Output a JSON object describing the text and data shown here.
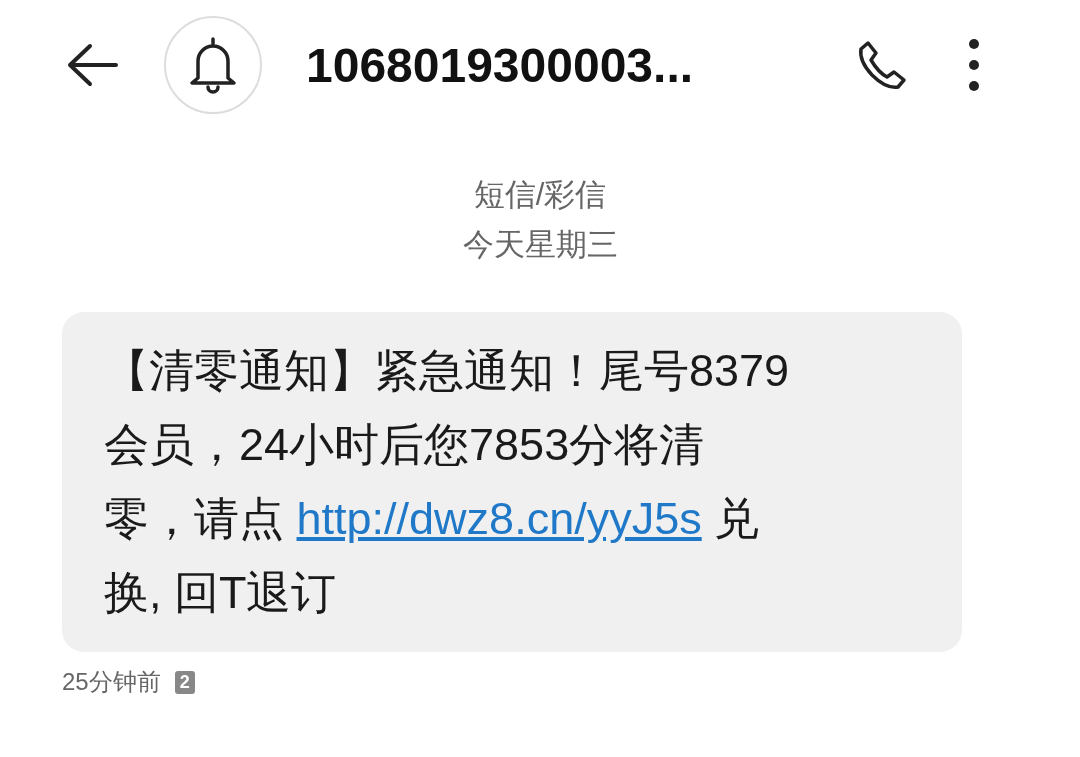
{
  "header": {
    "title": "1068019300003..."
  },
  "thread_info": {
    "channel": "短信/彩信",
    "date": "今天星期三"
  },
  "message": {
    "text_before": "【清零通知】紧急通知！尾号8379会员，24小时后您7853分将清零，请点 ",
    "link": "http://dwz8.cn/yyJ5s",
    "text_after": " 兑换, 回T退订"
  },
  "meta": {
    "time": "25分钟前",
    "sim": "2"
  }
}
